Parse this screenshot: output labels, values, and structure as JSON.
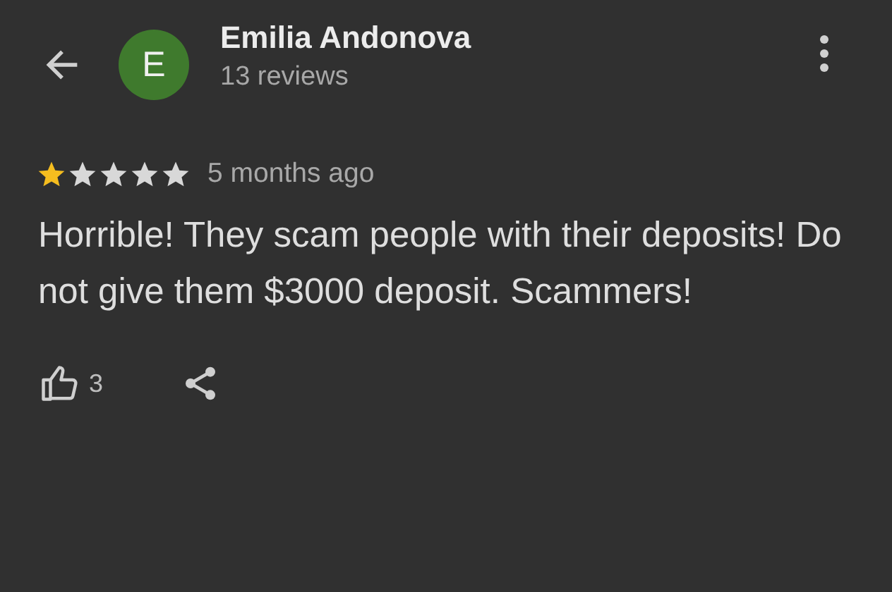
{
  "header": {
    "avatar_letter": "E",
    "name": "Emilia Andonova",
    "reviews": "13 reviews"
  },
  "review": {
    "stars": 1,
    "time": "5 months ago",
    "text": "Horrible! They scam people with their deposits! Do not give them $3000 deposit. Scammers!",
    "likes": "3"
  }
}
